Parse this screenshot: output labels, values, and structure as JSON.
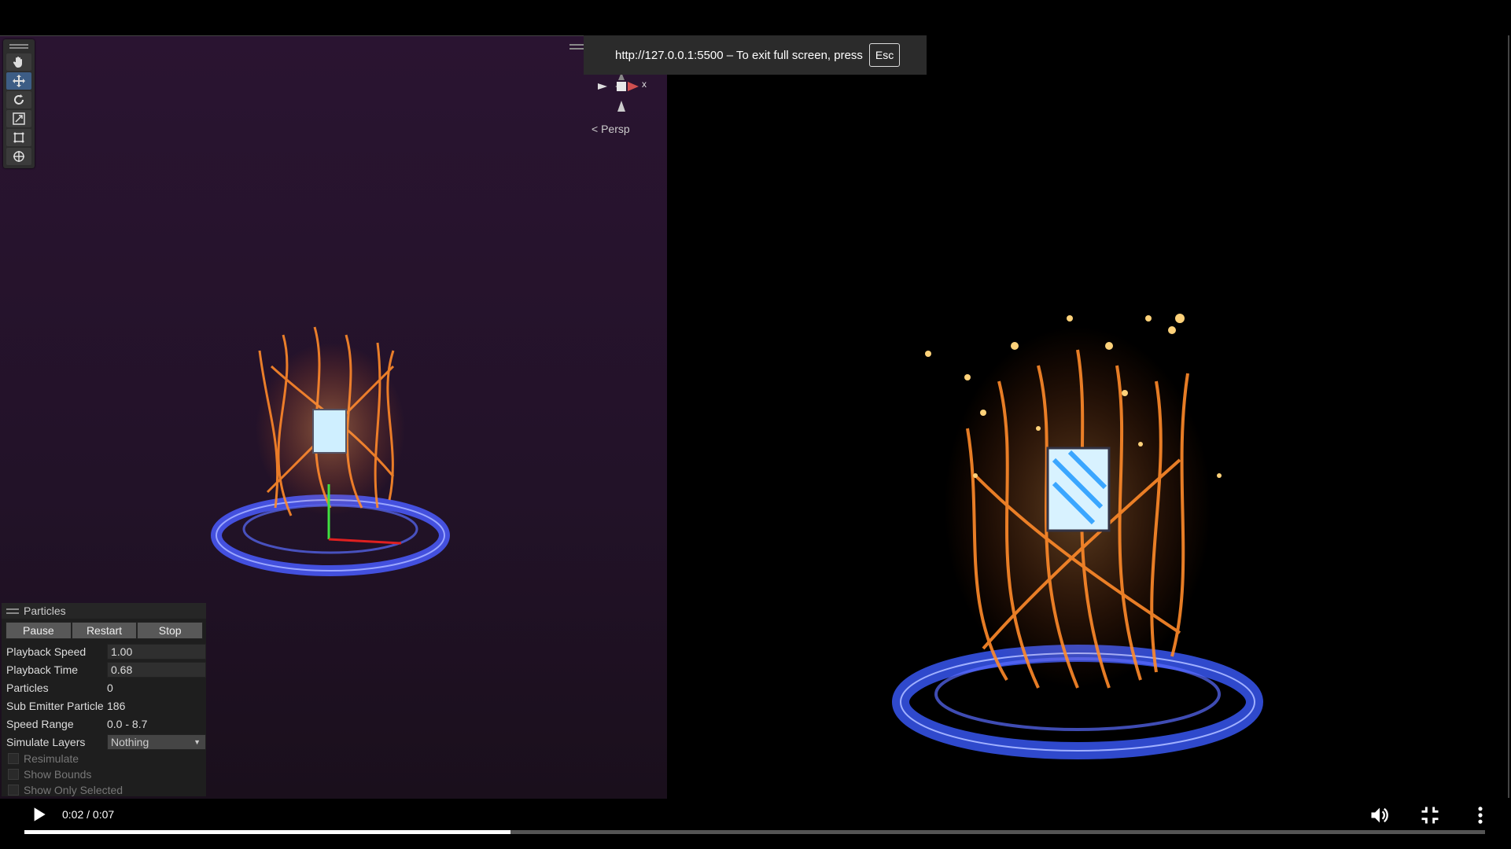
{
  "fullscreen_banner": {
    "text": "http://127.0.0.1:5500 – To exit full screen, press",
    "key": "Esc"
  },
  "scene": {
    "persp_label": "Persp",
    "gizmo_axis_label": "x",
    "tools": [
      "hand-icon",
      "move-icon",
      "rotate-icon",
      "scale-icon",
      "rect-icon",
      "transform-icon"
    ]
  },
  "particles_panel": {
    "title": "Particles",
    "buttons": {
      "pause": "Pause",
      "restart": "Restart",
      "stop": "Stop"
    },
    "rows": {
      "playback_speed": {
        "label": "Playback Speed",
        "value": "1.00"
      },
      "playback_time": {
        "label": "Playback Time",
        "value": "0.68"
      },
      "particles": {
        "label": "Particles",
        "value": "0"
      },
      "sub_emitter": {
        "label": "Sub Emitter Particle",
        "value": "186"
      },
      "speed_range": {
        "label": "Speed Range",
        "value": "0.0 - 8.7"
      },
      "simulate_layers": {
        "label": "Simulate Layers",
        "value": "Nothing"
      }
    },
    "checkboxes": {
      "resimulate": "Resimulate",
      "show_bounds": "Show Bounds",
      "show_only_selected": "Show Only Selected"
    }
  },
  "video": {
    "time": "0:02 / 0:07",
    "progress": 0.333,
    "icons": [
      "play-icon",
      "volume-icon",
      "exit-fullscreen-icon",
      "more-options-icon"
    ]
  },
  "colors": {
    "fire": "#ff8a2a",
    "ring": "#3b5bff",
    "scene_bg": "#2a1431"
  }
}
